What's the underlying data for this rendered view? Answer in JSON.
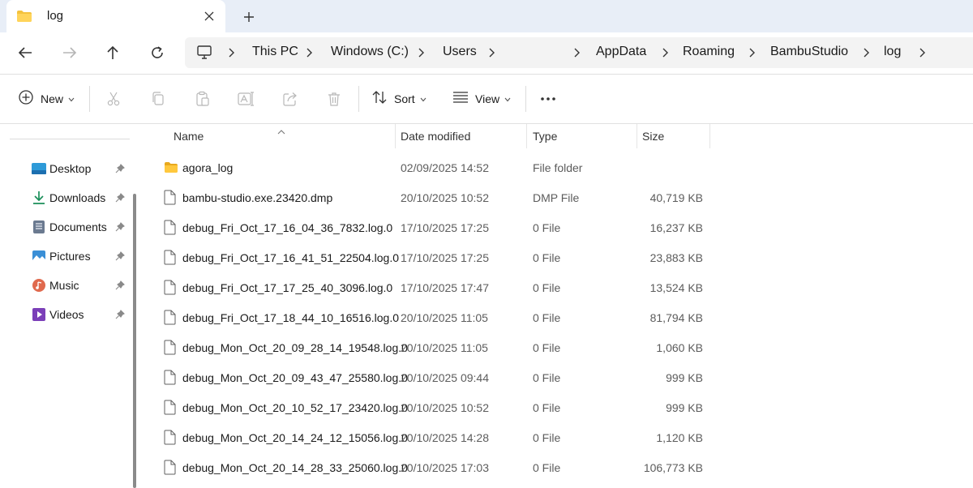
{
  "tab": {
    "title": "log",
    "close": "✕",
    "new": "+"
  },
  "breadcrumbs": [
    "This PC",
    "Windows (C:)",
    "Users",
    "AppData",
    "Roaming",
    "BambuStudio",
    "log"
  ],
  "toolbar": {
    "new_label": "New",
    "sort_label": "Sort",
    "view_label": "View",
    "more_label": "•••"
  },
  "sidebar": {
    "items": [
      {
        "label": "Desktop",
        "icon": "desktop-icon"
      },
      {
        "label": "Downloads",
        "icon": "downloads-icon"
      },
      {
        "label": "Documents",
        "icon": "documents-icon"
      },
      {
        "label": "Pictures",
        "icon": "pictures-icon"
      },
      {
        "label": "Music",
        "icon": "music-icon"
      },
      {
        "label": "Videos",
        "icon": "videos-icon"
      }
    ]
  },
  "columns": {
    "name": "Name",
    "date": "Date modified",
    "type": "Type",
    "size": "Size"
  },
  "files": [
    {
      "name": "agora_log",
      "date": "02/09/2025 14:52",
      "type": "File folder",
      "size": "",
      "kind": "folder"
    },
    {
      "name": "bambu-studio.exe.23420.dmp",
      "date": "20/10/2025 10:52",
      "type": "DMP File",
      "size": "40,719 KB",
      "kind": "file"
    },
    {
      "name": "debug_Fri_Oct_17_16_04_36_7832.log.0",
      "date": "17/10/2025 17:25",
      "type": "0 File",
      "size": "16,237 KB",
      "kind": "file"
    },
    {
      "name": "debug_Fri_Oct_17_16_41_51_22504.log.0",
      "date": "17/10/2025 17:25",
      "type": "0 File",
      "size": "23,883 KB",
      "kind": "file"
    },
    {
      "name": "debug_Fri_Oct_17_17_25_40_3096.log.0",
      "date": "17/10/2025 17:47",
      "type": "0 File",
      "size": "13,524 KB",
      "kind": "file"
    },
    {
      "name": "debug_Fri_Oct_17_18_44_10_16516.log.0",
      "date": "20/10/2025 11:05",
      "type": "0 File",
      "size": "81,794 KB",
      "kind": "file"
    },
    {
      "name": "debug_Mon_Oct_20_09_28_14_19548.log.0",
      "date": "20/10/2025 11:05",
      "type": "0 File",
      "size": "1,060 KB",
      "kind": "file"
    },
    {
      "name": "debug_Mon_Oct_20_09_43_47_25580.log.0",
      "date": "20/10/2025 09:44",
      "type": "0 File",
      "size": "999 KB",
      "kind": "file"
    },
    {
      "name": "debug_Mon_Oct_20_10_52_17_23420.log.0",
      "date": "20/10/2025 10:52",
      "type": "0 File",
      "size": "999 KB",
      "kind": "file"
    },
    {
      "name": "debug_Mon_Oct_20_14_24_12_15056.log.0",
      "date": "20/10/2025 14:28",
      "type": "0 File",
      "size": "1,120 KB",
      "kind": "file"
    },
    {
      "name": "debug_Mon_Oct_20_14_28_33_25060.log.0",
      "date": "20/10/2025 17:03",
      "type": "0 File",
      "size": "106,773 KB",
      "kind": "file"
    }
  ],
  "colors": {
    "tabstrip": "#e8eef7",
    "folder": "#f4c23d",
    "accent": "#0067c0"
  }
}
